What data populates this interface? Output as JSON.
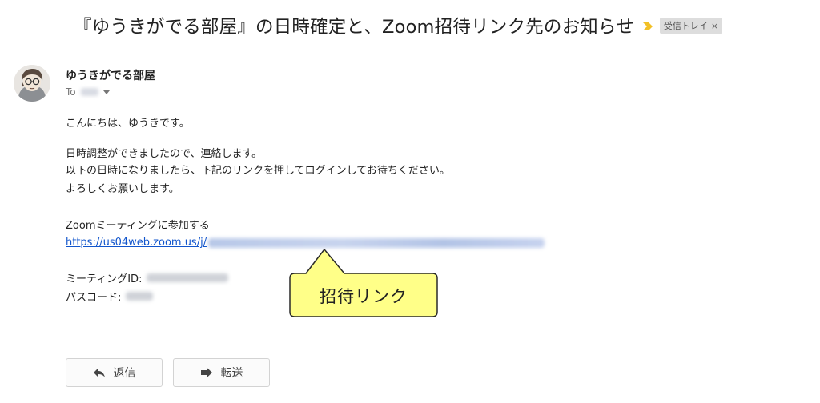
{
  "email": {
    "subject": "『ゆうきがでる部屋』の日時確定と、Zoom招待リンク先のお知らせ",
    "label_chip": "受信トレイ",
    "label_chip_close": "×",
    "sender_name": "ゆうきがでる部屋",
    "to_prefix": "To",
    "body": {
      "greeting": "こんにちは、ゆうきです。",
      "line1": "日時調整ができましたので、連絡します。",
      "line2": "以下の日時になりましたら、下記のリンクを押してログインしてお待ちください。",
      "line3": "よろしくお願いします。",
      "zoom_heading": "Zoomミーティングに参加する",
      "zoom_link": "https://us04web.zoom.us/j/",
      "meeting_id_label": "ミーティングID:",
      "passcode_label": "パスコード:"
    }
  },
  "annotation": {
    "label": "招待リンク",
    "fill": "#ffff88",
    "stroke": "#2a2a2a"
  },
  "actions": {
    "reply": "返信",
    "forward": "転送"
  },
  "colors": {
    "link": "#1155cc",
    "importance": "#f2c026",
    "text": "#222222"
  },
  "icons": {
    "importance": "importance-marker-icon",
    "reply": "reply-arrow-icon",
    "forward": "forward-arrow-icon",
    "avatar": "avatar-illustration",
    "caret": "caret-down-icon"
  }
}
